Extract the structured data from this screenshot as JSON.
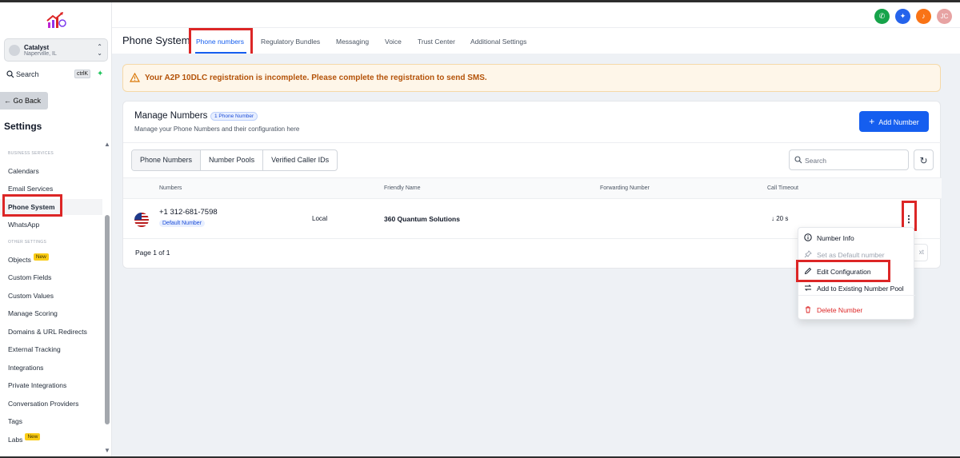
{
  "sidebar": {
    "account": {
      "name": "Catalyst",
      "location": "Naperville, IL"
    },
    "search": {
      "label": "Search",
      "shortcut": "ctrlK"
    },
    "go_back": "Go Back",
    "settings_title": "Settings",
    "section_business": "BUSINESS SERVICES",
    "section_other": "OTHER SETTINGS",
    "items": [
      {
        "label": "Calendars"
      },
      {
        "label": "Email Services"
      },
      {
        "label": "Phone System"
      },
      {
        "label": "WhatsApp"
      },
      {
        "label": "Objects",
        "badge": "New"
      },
      {
        "label": "Custom Fields"
      },
      {
        "label": "Custom Values"
      },
      {
        "label": "Manage Scoring"
      },
      {
        "label": "Domains & URL Redirects"
      },
      {
        "label": "External Tracking"
      },
      {
        "label": "Integrations"
      },
      {
        "label": "Private Integrations"
      },
      {
        "label": "Conversation Providers"
      },
      {
        "label": "Tags"
      },
      {
        "label": "Labs",
        "badge": "New"
      }
    ]
  },
  "topbar": {
    "user_initials": "JC",
    "colors": {
      "phone": "#16a34a",
      "sparkle": "#2563eb",
      "bell": "#f97316",
      "avatar": "#e7a3a3"
    }
  },
  "header": {
    "title": "Phone System",
    "tabs": [
      {
        "label": "Phone numbers"
      },
      {
        "label": "Regulatory Bundles"
      },
      {
        "label": "Messaging"
      },
      {
        "label": "Voice"
      },
      {
        "label": "Trust Center"
      },
      {
        "label": "Additional Settings"
      }
    ]
  },
  "alert": {
    "text": "Your A2P 10DLC registration is incomplete. Please complete the registration to send SMS."
  },
  "card": {
    "title": "Manage Numbers",
    "count_badge": "1 Phone Number",
    "subtitle": "Manage your Phone Numbers and their configuration here",
    "add_button": "Add Number",
    "segments": [
      "Phone Numbers",
      "Number Pools",
      "Verified Caller IDs"
    ],
    "search_placeholder": "Search",
    "columns": [
      "Numbers",
      "Friendly Name",
      "Forwarding Number",
      "Call Timeout"
    ],
    "rows": [
      {
        "number": "+1 312-681-7598",
        "default_badge": "Default Number",
        "type": "Local",
        "friendly_name": "360 Quantum Solutions",
        "call_timeout": "20 s"
      }
    ],
    "pager": "Page 1 of 1",
    "next_label": "xt"
  },
  "menu": {
    "items": [
      {
        "label": "Number Info"
      },
      {
        "label": "Set as Default number"
      },
      {
        "label": "Edit Configuration"
      },
      {
        "label": "Add to Existing Number Pool"
      },
      {
        "label": "Delete Number"
      }
    ]
  }
}
